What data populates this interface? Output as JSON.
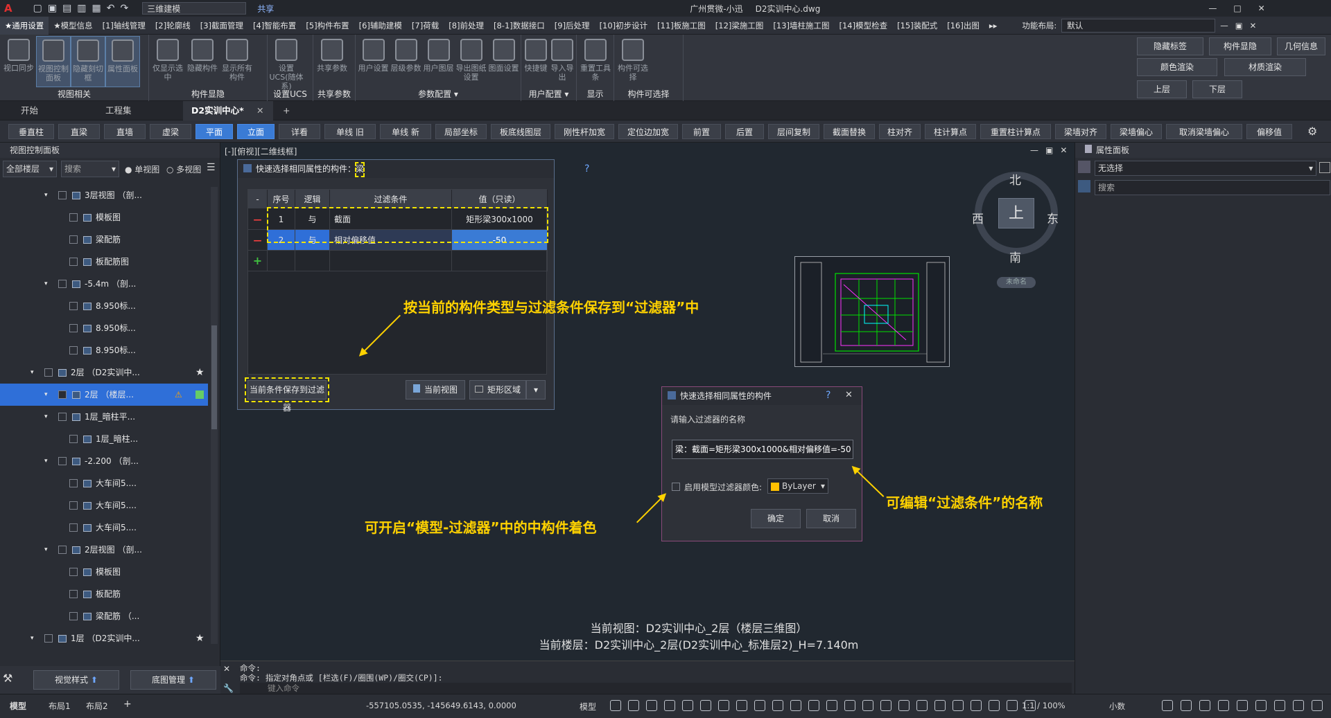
{
  "titlebar": {
    "quick_access": "三维建模",
    "share": "共享",
    "user": "广州贯微-小迅",
    "filename": "D2实训中心.dwg",
    "window_min": "—",
    "window_max": "□",
    "window_close": "✕"
  },
  "menubar": {
    "items": [
      "★通用设置",
      "★模型信息",
      "[1]轴线管理",
      "[2]轮廓线",
      "[3]截面管理",
      "[4]智能布置",
      "[5]构件布置",
      "[6]辅助建模",
      "[7]荷载",
      "[8]前处理",
      "[8-1]数据接口",
      "[9]后处理",
      "[10]初步设计",
      "[11]板施工图",
      "[12]梁施工图",
      "[13]墙柱施工图",
      "[14]模型检查",
      "[15]装配式",
      "[16]出图"
    ],
    "layout_label": "功能布局:",
    "layout_value": "默认"
  },
  "ribbon": {
    "groups": [
      {
        "label": "视图相关",
        "buttons": [
          "视口同步",
          "视图控制面板",
          "隐藏刻切框",
          "属性面板"
        ]
      },
      {
        "label": "构件显隐",
        "buttons": [
          "仅显示选中",
          "隐藏构件",
          "显示所有构件"
        ]
      },
      {
        "label": "设置UCS",
        "buttons": [
          "设置UCS(随体系)"
        ]
      },
      {
        "label": "共享参数",
        "buttons": [
          "共享参数"
        ]
      },
      {
        "label": "参数配置 ▾",
        "buttons": [
          "用户设置",
          "层级参数",
          "用户图层",
          "导出图纸设置",
          "图面设置"
        ]
      },
      {
        "label": "用户配置 ▾",
        "buttons": [
          "快捷键",
          "导入导出"
        ]
      },
      {
        "label": "显示",
        "buttons": [
          "重置工具条"
        ]
      },
      {
        "label": "构件可选择",
        "buttons": [
          "构件可选择"
        ]
      }
    ],
    "right_buttons": [
      "隐藏标签",
      "构件显隐",
      "几何信息",
      "颜色渲染",
      "材质渲染",
      "上层",
      "下层"
    ]
  },
  "doctabs": [
    "开始",
    "工程集",
    "D2实训中心*"
  ],
  "toolbar2": [
    "垂直柱",
    "直梁",
    "直墙",
    "虚梁",
    "平面",
    "立面",
    "详看",
    "单线 旧",
    "单线 新",
    "局部坐标",
    "板底线图层",
    "刚性杆加宽",
    "定位边加宽",
    "前置",
    "后置",
    "层间复制",
    "截面替换",
    "柱对齐",
    "柱计算点",
    "重置柱计算点",
    "梁墙对齐",
    "梁墙偏心",
    "取消梁墙偏心",
    "偏移值"
  ],
  "leftpanel": {
    "title": "视图控制面板",
    "floor_filter": "全部楼层",
    "search_placeholder": "搜索",
    "single_view": "单视图",
    "multi_view": "多视图",
    "tree": [
      {
        "label": "3层视图 （剖...",
        "level": 1
      },
      {
        "label": "模板图",
        "level": 2
      },
      {
        "label": "梁配筋",
        "level": 2
      },
      {
        "label": "板配筋图",
        "level": 2
      },
      {
        "label": "-5.4m （剖...",
        "level": 1
      },
      {
        "label": "8.950标...",
        "level": 2
      },
      {
        "label": "8.950标...",
        "level": 2
      },
      {
        "label": "8.950标...",
        "level": 2
      },
      {
        "label": "2层 （D2实训中...",
        "level": 0
      },
      {
        "label": "2层 （楼层...",
        "level": 1
      },
      {
        "label": "1层_暗柱平...",
        "level": 1
      },
      {
        "label": "1层_暗柱...",
        "level": 2
      },
      {
        "label": "-2.200 （剖...",
        "level": 1
      },
      {
        "label": "大车间5....",
        "level": 2
      },
      {
        "label": "大车间5....",
        "level": 2
      },
      {
        "label": "大车间5....",
        "level": 2
      },
      {
        "label": "2层视图 （剖...",
        "level": 1
      },
      {
        "label": "模板图",
        "level": 2
      },
      {
        "label": "板配筋",
        "level": 2
      },
      {
        "label": "梁配筋 （...",
        "level": 2
      },
      {
        "label": "1层 （D2实训中...",
        "level": 0
      }
    ],
    "bottom_visual": "视觉样式",
    "bottom_base": "底图管理"
  },
  "viewport": {
    "label": "[-][俯视][二维线框]",
    "compass": {
      "north": "北",
      "south": "南",
      "east": "东",
      "west": "西",
      "center": "上",
      "unnamed": "未命名"
    },
    "current_view": "当前视图：D2实训中心_2层（楼层三维图）",
    "current_floor": "当前楼层：D2实训中心_2层(D2实训中心_标准层2)_H=7.140m"
  },
  "dialog1": {
    "title": "快速选择相同属性的构件：",
    "title_type": "梁",
    "help": "?",
    "close": "✕",
    "headers": [
      "-",
      "序号",
      "逻辑",
      "过滤条件",
      "值（只读）"
    ],
    "rows": [
      {
        "num": "1",
        "logic": "与",
        "cond": "截面",
        "value": "矩形梁300x1000"
      },
      {
        "num": "2",
        "logic": "与",
        "cond": "相对偏移值",
        "value": "-50"
      }
    ],
    "save_btn": "当前条件保存到过滤器",
    "current_view_btn": "当前视图",
    "rect_btn": "矩形区域"
  },
  "dialog2": {
    "title": "快速选择相同属性的构件",
    "help": "?",
    "close": "✕",
    "prompt": "请输入过滤器的名称",
    "input_value": "梁：截面=矩形梁300x1000&相对偏移值=-50",
    "color_label": "启用模型过滤器颜色:",
    "color_value": "ByLayer",
    "ok": "确定",
    "cancel": "取消"
  },
  "annotations": {
    "a1": "按当前的构件类型与过滤条件保存到“过滤器”中",
    "a2": "可编辑“过滤条件”的名称",
    "a3": "可开启“模型-过滤器”中的中构件着色"
  },
  "rightpanel": {
    "title": "属性面板",
    "select_value": "无选择",
    "search_placeholder": "搜索"
  },
  "cmd": {
    "line1": "命令:",
    "line2": "命令: 指定对角点或 [栏选(F)/圈围(WP)/圈交(CP)]:",
    "input_placeholder": "键入命令"
  },
  "statusbar": {
    "tabs": [
      "模型",
      "布局1",
      "布局2"
    ],
    "coords": "-557105.0535, -145649.6143, 0.0000",
    "model": "模型",
    "scale": "1:1 / 100%",
    "decimal": "小数"
  },
  "colors": {
    "accent": "#3a7bd5",
    "highlight": "#ffd200",
    "selected_row": "#2f6fd8"
  }
}
